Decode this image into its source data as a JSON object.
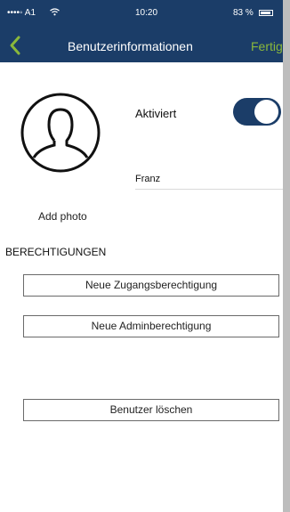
{
  "status": {
    "carrier": "••••◦ A1",
    "wifi_icon": "wifi-icon",
    "time": "10:20",
    "battery": "83 %"
  },
  "nav": {
    "title": "Benutzerinformationen",
    "done_label": "Fertig",
    "back_icon": "chevron-left-icon",
    "accent_color": "#8ab83b",
    "bar_color": "#1b3d68"
  },
  "profile": {
    "add_photo_label": "Add photo",
    "active_label": "Aktiviert",
    "active": true,
    "name_value": "Franz"
  },
  "permissions": {
    "section_title": "BERECHTIGUNGEN",
    "new_access_label": "Neue Zugangsberechtigung",
    "new_admin_label": "Neue Adminberechtigung"
  },
  "delete_user_label": "Benutzer löschen"
}
